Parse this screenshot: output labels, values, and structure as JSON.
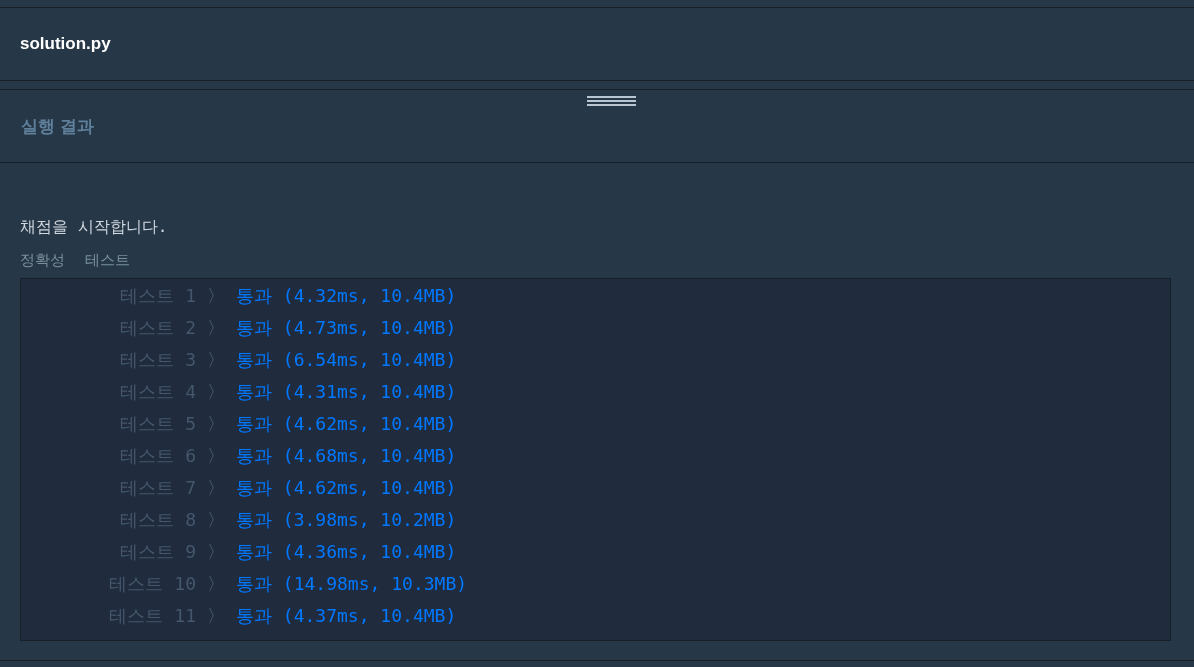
{
  "file_tab": {
    "title": "solution.py"
  },
  "result_panel": {
    "title": "실행 결과"
  },
  "output": {
    "intro": "채점을 시작합니다.",
    "section": [
      "정확성",
      "테스트"
    ],
    "rows": [
      {
        "label": "테스트 1",
        "separator": "〉",
        "result": "통과 (4.32ms, 10.4MB)"
      },
      {
        "label": "테스트 2",
        "separator": "〉",
        "result": "통과 (4.73ms, 10.4MB)"
      },
      {
        "label": "테스트 3",
        "separator": "〉",
        "result": "통과 (6.54ms, 10.4MB)"
      },
      {
        "label": "테스트 4",
        "separator": "〉",
        "result": "통과 (4.31ms, 10.4MB)"
      },
      {
        "label": "테스트 5",
        "separator": "〉",
        "result": "통과 (4.62ms, 10.4MB)"
      },
      {
        "label": "테스트 6",
        "separator": "〉",
        "result": "통과 (4.68ms, 10.4MB)"
      },
      {
        "label": "테스트 7",
        "separator": "〉",
        "result": "통과 (4.62ms, 10.4MB)"
      },
      {
        "label": "테스트 8",
        "separator": "〉",
        "result": "통과 (3.98ms, 10.2MB)"
      },
      {
        "label": "테스트 9",
        "separator": "〉",
        "result": "통과 (4.36ms, 10.4MB)"
      },
      {
        "label": "테스트 10",
        "separator": "〉",
        "result": "통과 (14.98ms, 10.3MB)"
      },
      {
        "label": "테스트 11",
        "separator": "〉",
        "result": "통과 (4.37ms, 10.4MB)"
      }
    ]
  }
}
